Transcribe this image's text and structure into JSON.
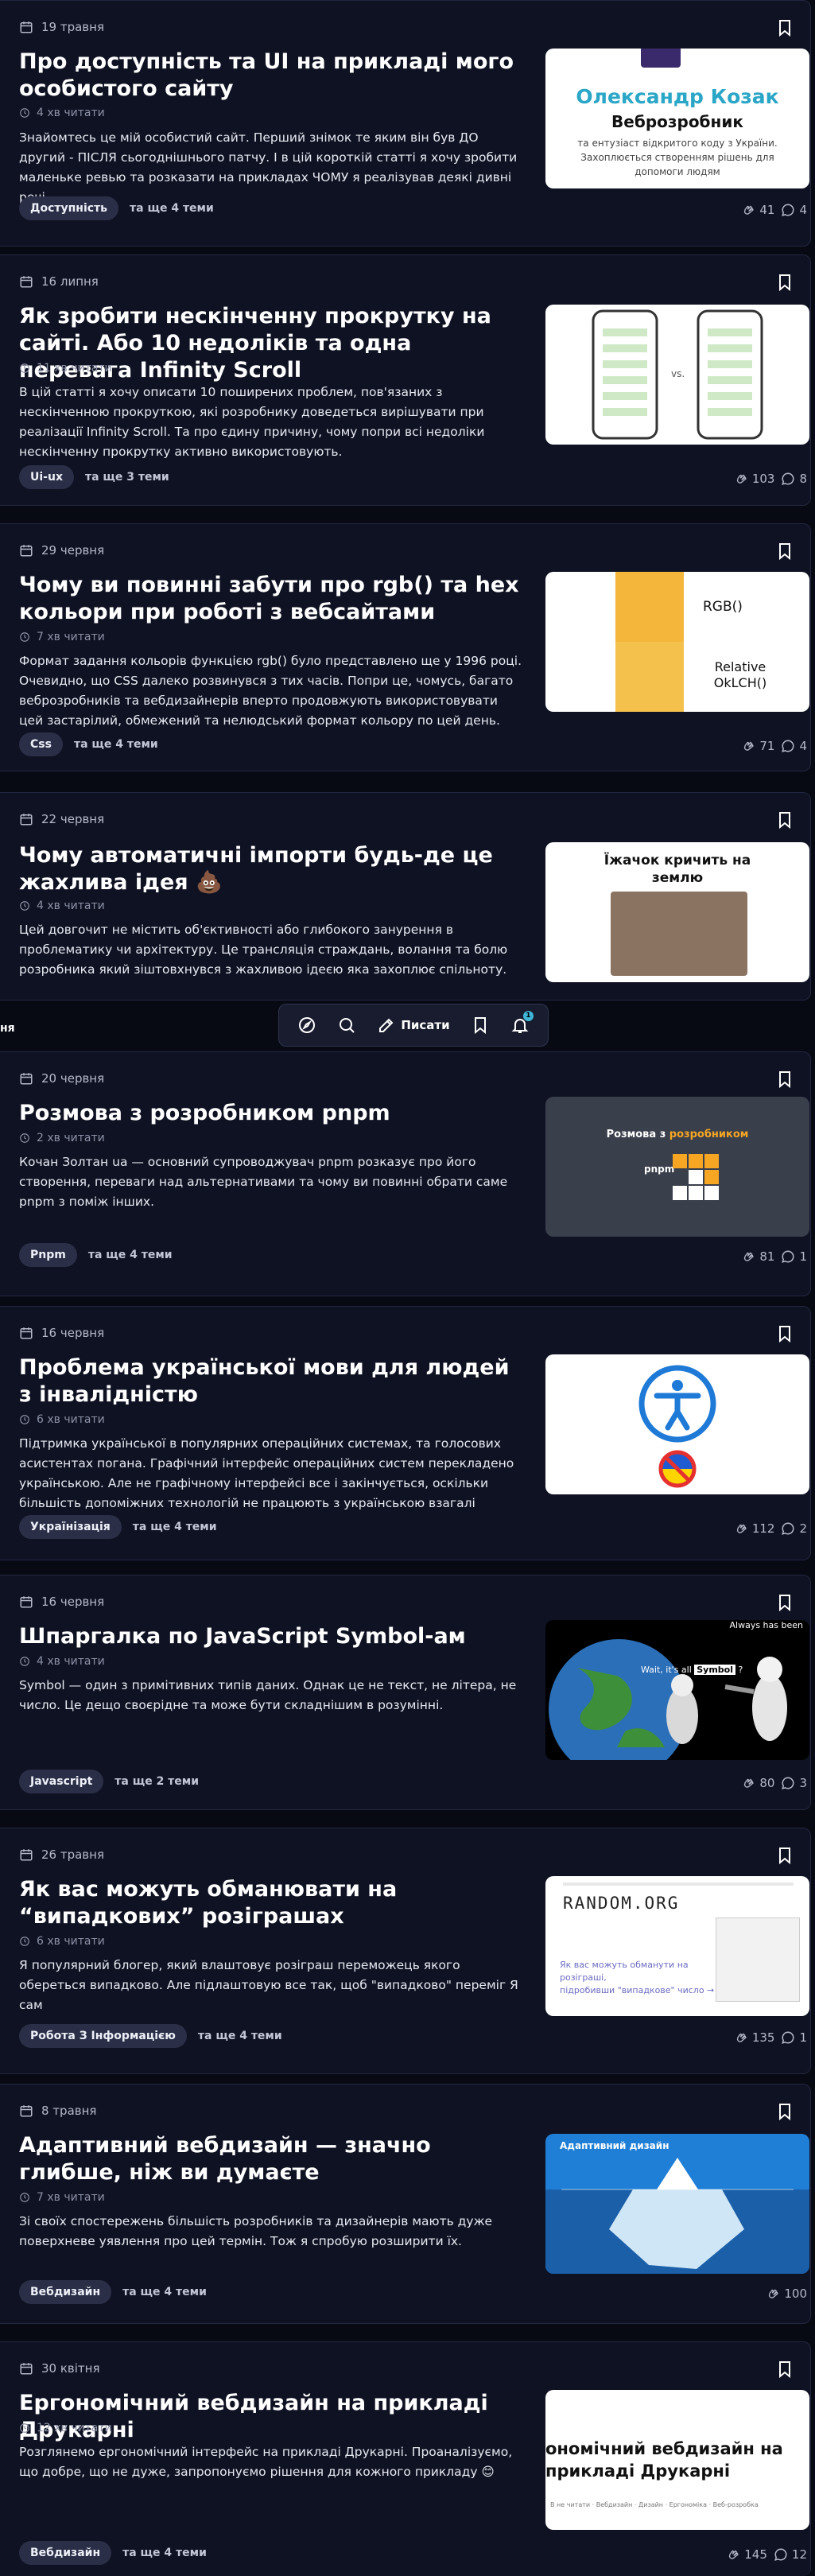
{
  "articles": [
    {
      "date": "19 травня",
      "title": "Про доступність та UI на прикладі мого особистого сайту",
      "read_time": "4 хв читати",
      "excerpt": "Знайомтесь це мій особистий сайт. Перший знімок те яким він був ДО другий - ПІСЛЯ сьогоднішнього патчу. І в цій короткій статті я хочу зробити маленьке ревью та розказати на прикладах ЧОМУ я реалізував деякі дивні речі.",
      "tag": "Доступність",
      "more_topics": "та ще 4 теми",
      "claps": "41",
      "comments": "4",
      "thumb": {
        "name": "Олександр Козак",
        "role": "Веброзробник",
        "text": "та ентузіаст відкритого коду з України. Захоплюється створенням рішень для допомоги людям"
      }
    },
    {
      "date": "16 липня",
      "title": "Як зробити нескінченну прокрутку на сайті. Або 10 недоліків та одна перевага Infinity Scroll",
      "read_time": "11 хв читати",
      "excerpt": "В цій статті я хочу описати 10 поширених проблем, пов'язаних з нескінченною прокруткою, які розробнику доведеться вирішувати при реалізації Infinity Scroll. Та про єдину причину, чому попри всі недоліки нескінченну прокрутку активно використовують.",
      "tag": "Ui-ux",
      "more_topics": "та ще 3 теми",
      "claps": "103",
      "comments": "8",
      "thumb": {
        "vs": "vs."
      }
    },
    {
      "date": "29 червня",
      "title": "Чому ви повинні забути про rgb() та hex кольори при роботі з вебсайтами",
      "read_time": "7 хв читати",
      "excerpt": "Формат задання кольорів функцією rgb() було представлено ще у 1996 році. Очевидно, що CSS далеко розвинувся з тих часів. Попри це, чомусь, багато веброзробників та вебдизайнерів вперто продовжують використовувати цей застарілий, обмежений та нелюдський формат кольору по цей день.",
      "tag": "Css",
      "more_topics": "та ще 4 теми",
      "claps": "71",
      "comments": "4",
      "thumb": {
        "top": "RGB()",
        "bottom": "Relative OkLCH()"
      }
    },
    {
      "date": "22 червня",
      "title": "Чому автоматичні імпорти будь-де це жахлива ідея 💩",
      "read_time": "4 хв читати",
      "excerpt": "Цей довгочит не містить об'єктивності або глибокого занурення в проблематику чи архітектуру. Це трансляція страждань, волання та болю розробника який зіштовхнувся з жахливою ідеєю яка захоплює спільноту.",
      "thumb": {
        "caption": "Їжачок кричить на землю"
      }
    },
    {
      "date": "20 червня",
      "title": "Розмова з розробником pnpm",
      "read_time": "2 хв читати",
      "excerpt": "Кочан Золтан ua — основний супроводжувач pnpm розказує про його створення, переваги над альтернативами та чому ви повинні обрати саме pnpm з поміж інших.",
      "tag": "Pnpm",
      "more_topics": "та ще 4 теми",
      "claps": "81",
      "comments": "1",
      "thumb": {
        "prefix": "Розмова з ",
        "highlight": "розробником",
        "logo": "pnpm"
      }
    },
    {
      "date": "16 червня",
      "title": "Проблема української мови для людей з інвалідністю",
      "read_time": "6 хв читати",
      "excerpt": "Підтримка української в популярних операційних системах, та голосових асистентах погана. Графічний інтерфейс операційних систем перекладено українською. Але не графічному інтерфейсі все і закінчується, оскільки більшість допоміжних технологій не працюють з українською взагалі",
      "tag": "Українізація",
      "more_topics": "та ще 4 теми",
      "claps": "112",
      "comments": "2"
    },
    {
      "date": "16 червня",
      "title": "Шпаргалка по JavaScript Symbol-ам",
      "read_time": "4 хв читати",
      "excerpt": "Symbol — один з примітивних типів даних. Однак це не текст, не літера, не число. Це дещо своєрідне та може бути складнішим в розумінні.",
      "tag": "Javascript",
      "more_topics": "та ще 2 теми",
      "claps": "80",
      "comments": "3",
      "thumb": {
        "meme_top": "Always has been",
        "meme_mid": "Wait, it's all",
        "meme_word": "Symbol",
        "meme_q": "?"
      }
    },
    {
      "date": "26 травня",
      "title": "Як вас можуть обманювати на “випадкових” розіграшах",
      "read_time": "6 хв читати",
      "excerpt": "Я популярний блогер, який влаштовує розіграш переможець якого обереться випадково. Але підлаштовую все так, щоб \"випадково\" переміг Я сам",
      "tag": "Робота З Інформацією",
      "more_topics": "та ще 4 теми",
      "claps": "135",
      "comments": "1",
      "thumb": {
        "logo": "RANDOM.ORG",
        "line1": "Як вас можуть обманути на розіграші,",
        "line2": "підробивши \"випадкове\" число →"
      }
    },
    {
      "date": "8 травня",
      "title": "Адаптивний вебдизайн — значно глибше, ніж ви думаєте",
      "read_time": "7 хв читати",
      "excerpt": "Зі своїх спостережень більшість розробників та дизайнерів мають дуже поверхневе уявлення про цей термін. Тож я спробую розширити їх.",
      "tag": "Вебдизайн",
      "more_topics": "та ще 4 теми",
      "claps": "100",
      "comments": "",
      "thumb": {
        "caption": "Адаптивний дизайн"
      }
    },
    {
      "date": "30 квітня",
      "title": "Ергономічний вебдизайн на прикладі Друкарні",
      "read_time": "12 хв читати",
      "excerpt": "Розглянемо ергономічний інтерфейс на прикладі Друкарні. Проаналізуємо, що добре, що не дуже, запропонуємо рішення для кожного прикладу 😊",
      "tag": "Вебдизайн",
      "more_topics": "та ще 4 теми",
      "claps": "145",
      "comments": "12",
      "thumb": {
        "big": "ономічний вебдизайн на прикладі Друкарні",
        "small": "В не читати · Вебдизайн · Дизайн · Ергономіка · Веб-розробка"
      }
    }
  ],
  "navbar": {
    "write_label": "Писати",
    "notif_count": "1"
  },
  "left_fragment": "ня",
  "colors": {
    "bg": "#070913",
    "card": "#0f1222",
    "accent": "#3fb6d8",
    "tag_bg": "#2a2f47"
  }
}
